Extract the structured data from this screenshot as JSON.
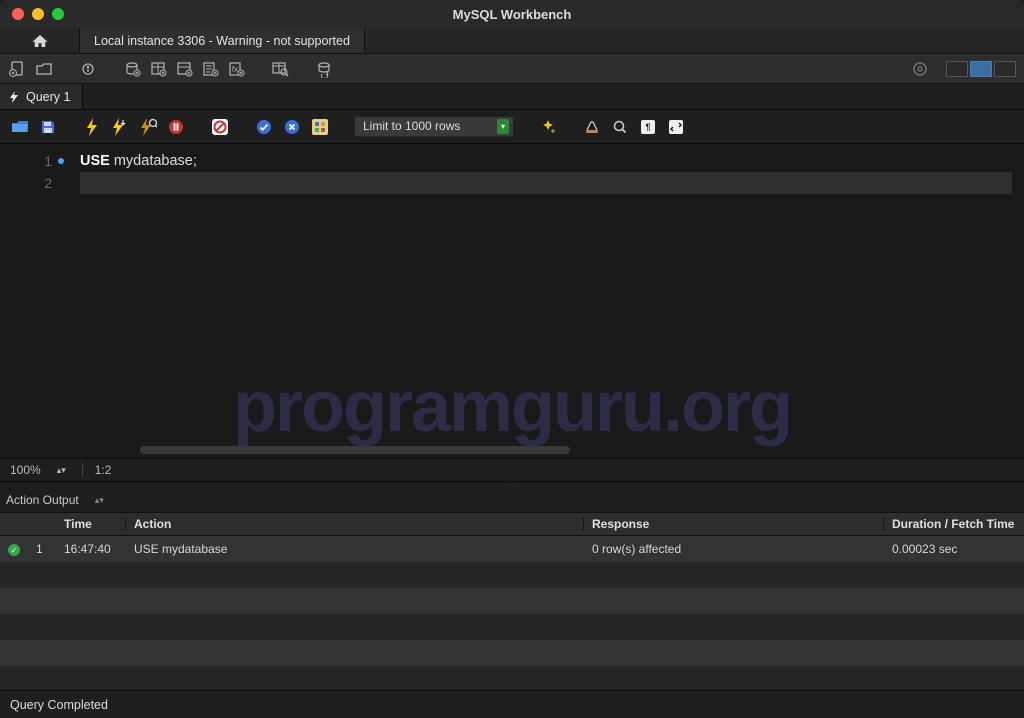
{
  "window": {
    "title": "MySQL Workbench"
  },
  "connection_tab": {
    "label": "Local instance 3306 - Warning - not supported"
  },
  "query_tab": {
    "label": "Query 1"
  },
  "editor_toolbar": {
    "limit_label": "Limit to 1000 rows"
  },
  "editor": {
    "lines": [
      {
        "n": "1",
        "kwd": "USE",
        "rest": " mydatabase;"
      },
      {
        "n": "2",
        "kwd": "",
        "rest": ""
      }
    ],
    "watermark": "programguru.org"
  },
  "editor_status": {
    "zoom": "100%",
    "pos": "1:2"
  },
  "output": {
    "dropdown": "Action Output",
    "headers": {
      "time": "Time",
      "action": "Action",
      "response": "Response",
      "duration": "Duration / Fetch Time"
    },
    "rows": [
      {
        "seq": "1",
        "time": "16:47:40",
        "action": "USE mydatabase",
        "response": "0 row(s) affected",
        "duration": "0.00023 sec"
      }
    ]
  },
  "footer": {
    "status": "Query Completed"
  }
}
